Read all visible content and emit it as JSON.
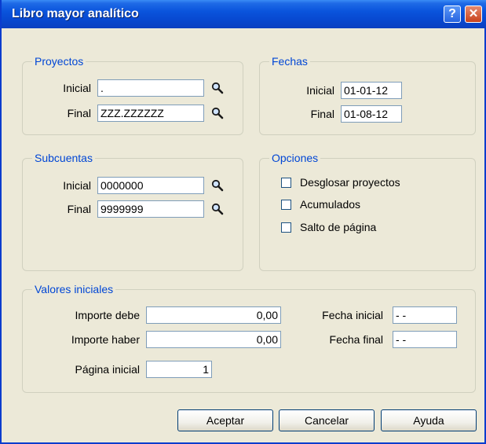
{
  "window": {
    "title": "Libro mayor analítico",
    "help_label": "?",
    "close_label": "✕"
  },
  "proyectos": {
    "legend": "Proyectos",
    "inicial_label": "Inicial",
    "inicial_value": ".",
    "final_label": "Final",
    "final_value": "ZZZ.ZZZZZZ"
  },
  "fechas": {
    "legend": "Fechas",
    "inicial_label": "Inicial",
    "inicial_value": "01-01-12",
    "final_label": "Final",
    "final_value": "01-08-12"
  },
  "subcuentas": {
    "legend": "Subcuentas",
    "inicial_label": "Inicial",
    "inicial_value": "0000000",
    "final_label": "Final",
    "final_value": "9999999"
  },
  "opciones": {
    "legend": "Opciones",
    "items": [
      {
        "label": "Desglosar proyectos",
        "checked": false
      },
      {
        "label": "Acumulados",
        "checked": false
      },
      {
        "label": "Salto de página",
        "checked": false
      }
    ]
  },
  "valores": {
    "legend": "Valores iniciales",
    "importe_debe_label": "Importe debe",
    "importe_debe_value": "0,00",
    "importe_haber_label": "Importe haber",
    "importe_haber_value": "0,00",
    "pagina_inicial_label": "Página inicial",
    "pagina_inicial_value": "1",
    "fecha_inicial_label": "Fecha inicial",
    "fecha_inicial_value": "- -",
    "fecha_final_label": "Fecha final",
    "fecha_final_value": "- -"
  },
  "buttons": {
    "aceptar": "Aceptar",
    "cancelar": "Cancelar",
    "ayuda": "Ayuda"
  },
  "icons": {
    "lookup": "magnifier-icon"
  }
}
